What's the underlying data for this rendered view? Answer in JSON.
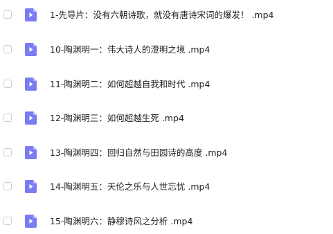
{
  "colors": {
    "icon_fill": "#7b7cf2",
    "icon_fold": "#b7b8fa",
    "checkbox_border": "#c9ced6",
    "text": "#222222"
  },
  "file_icon": "video-file-icon",
  "files": [
    {
      "name": "1-先导片：没有六朝诗歌，就没有唐诗宋词的爆发！ .mp4"
    },
    {
      "name": "10-陶渊明一：伟大诗人的澄明之境 .mp4"
    },
    {
      "name": "11-陶渊明二：如何超越自我和时代 .mp4"
    },
    {
      "name": "12-陶渊明三：如何超越生死 .mp4"
    },
    {
      "name": "13-陶渊明四：回归自然与田园诗的高度 .mp4"
    },
    {
      "name": "14-陶渊明五：天伦之乐与人世忘忧 .mp4"
    },
    {
      "name": "15-陶渊明六：静穆诗风之分析 .mp4"
    }
  ]
}
